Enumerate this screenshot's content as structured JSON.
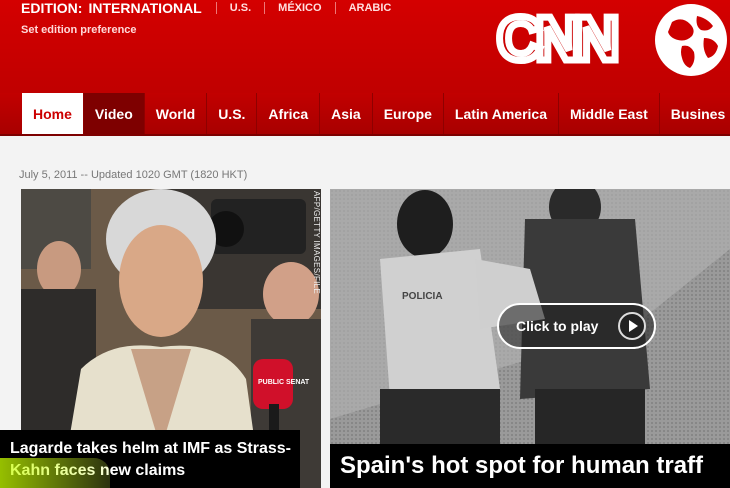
{
  "header": {
    "edition_label": "EDITION:",
    "edition_selected": "INTERNATIONAL",
    "edition_links": [
      "U.S.",
      "MÉXICO",
      "ARABIC"
    ],
    "set_preference": "Set edition preference",
    "logo_text": "CNN",
    "brand_color": "#cc0000"
  },
  "nav": {
    "items": [
      {
        "label": "Home"
      },
      {
        "label": "Video"
      },
      {
        "label": "World"
      },
      {
        "label": "U.S."
      },
      {
        "label": "Africa"
      },
      {
        "label": "Asia"
      },
      {
        "label": "Europe"
      },
      {
        "label": "Latin America"
      },
      {
        "label": "Middle East"
      },
      {
        "label": "Busines"
      }
    ],
    "active": "Home"
  },
  "main": {
    "dateline": "July 5, 2011 -- Updated 1020 GMT (1820 HKT)",
    "story1": {
      "photo_credit": "AFP/GETTY IMAGES/FILE",
      "headline": "Lagarde takes helm at IMF as Strass-Kahn faces new claims",
      "badge_text": "PUBLIC SENAT"
    },
    "story2": {
      "play_label": "Click to play",
      "headline": "Spain's hot spot for human traff",
      "vest_text": "POLICIA"
    }
  }
}
